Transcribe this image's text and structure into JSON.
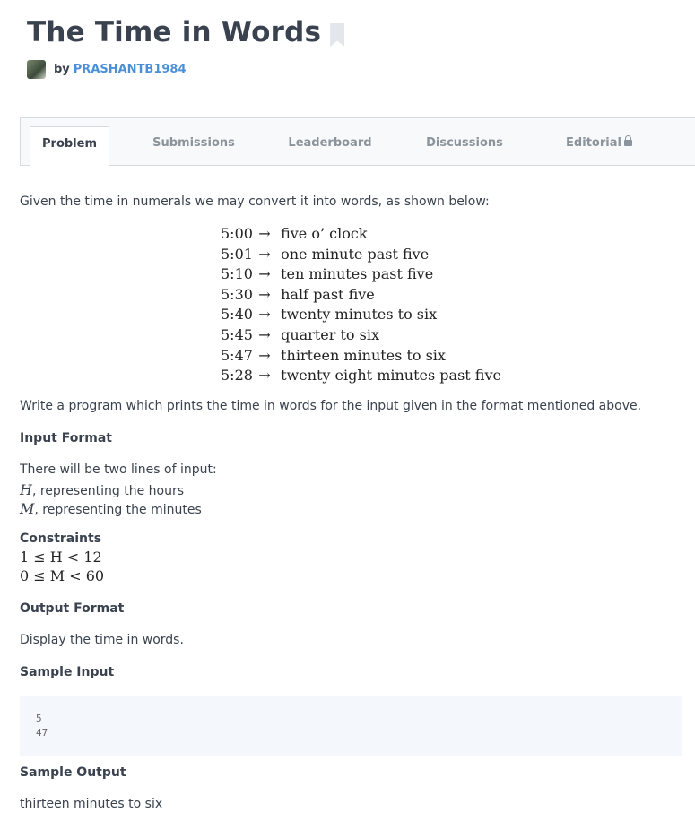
{
  "challenge": {
    "title": "The Time in Words",
    "author_prefix": "by",
    "author": "PRASHANTB1984"
  },
  "tabs": [
    {
      "label": "Problem",
      "active": true
    },
    {
      "label": "Submissions"
    },
    {
      "label": "Leaderboard"
    },
    {
      "label": "Discussions"
    },
    {
      "label": "Editorial"
    }
  ],
  "problem": {
    "intro": "Given the time in numerals we may convert it into words, as shown below:",
    "examples": [
      {
        "time": "5:00",
        "words": "five o’ clock"
      },
      {
        "time": "5:01",
        "words": "one minute past five"
      },
      {
        "time": "5:10",
        "words": "ten minutes past five"
      },
      {
        "time": "5:30",
        "words": "half past five"
      },
      {
        "time": "5:40",
        "words": "twenty minutes to six"
      },
      {
        "time": "5:45",
        "words": "quarter to six"
      },
      {
        "time": "5:47",
        "words": "thirteen minutes to six"
      },
      {
        "time": "5:28",
        "words": "twenty eight minutes past five"
      }
    ],
    "arrow": "→",
    "task": "Write a program which prints the time in words for the input given in the format mentioned above.",
    "input_heading": "Input Format",
    "input_line1": "There will be two lines of input:",
    "input_h_var": "H",
    "input_h_desc": ", representing the hours",
    "input_m_var": "M",
    "input_m_desc": ", representing the minutes",
    "constraints_heading": "Constraints",
    "constraint1": "1 ≤ H < 12",
    "constraint2": "0 ≤ M < 60",
    "output_heading": "Output Format",
    "output_desc": "Display the time in words.",
    "sample_input_heading": "Sample Input",
    "sample_input_line1": "5",
    "sample_input_line2": "47",
    "sample_output_heading": "Sample Output",
    "sample_output": "thirteen minutes to six"
  }
}
